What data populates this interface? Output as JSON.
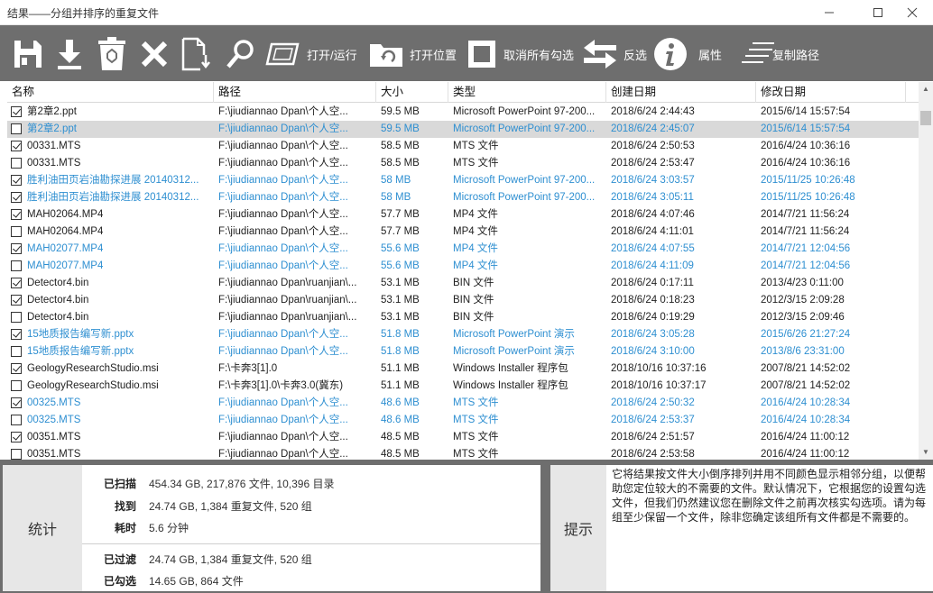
{
  "window": {
    "title": "结果——分组并排序的重复文件"
  },
  "toolbar": {
    "open_run": "打开/运行",
    "open_location": "打开位置",
    "uncheck_all": "取消所有勾选",
    "invert": "反选",
    "properties": "属性",
    "copy_path": "复制路径"
  },
  "table": {
    "columns": [
      "名称",
      "路径",
      "大小",
      "类型",
      "创建日期",
      "修改日期"
    ],
    "rows": [
      {
        "name": "第2章2.ppt",
        "path": "F:\\jiudiannao  Dpan\\个人空...",
        "size": "59.5 MB",
        "type": "Microsoft PowerPoint 97-200...",
        "created": "2018/6/24 2:44:43",
        "modified": "2015/6/14 15:57:54",
        "checked": true,
        "blue": false,
        "selected": false
      },
      {
        "name": "第2章2.ppt",
        "path": "F:\\jiudiannao  Dpan\\个人空...",
        "size": "59.5 MB",
        "type": "Microsoft PowerPoint 97-200...",
        "created": "2018/6/24 2:45:07",
        "modified": "2015/6/14 15:57:54",
        "checked": false,
        "blue": true,
        "selected": true
      },
      {
        "name": "00331.MTS",
        "path": "F:\\jiudiannao  Dpan\\个人空...",
        "size": "58.5 MB",
        "type": "MTS 文件",
        "created": "2018/6/24 2:50:53",
        "modified": "2016/4/24 10:36:16",
        "checked": true,
        "blue": false,
        "selected": false
      },
      {
        "name": "00331.MTS",
        "path": "F:\\jiudiannao  Dpan\\个人空...",
        "size": "58.5 MB",
        "type": "MTS 文件",
        "created": "2018/6/24 2:53:47",
        "modified": "2016/4/24 10:36:16",
        "checked": false,
        "blue": false,
        "selected": false
      },
      {
        "name": "胜利油田页岩油勘探进展 20140312...",
        "path": "F:\\jiudiannao  Dpan\\个人空...",
        "size": "58 MB",
        "type": "Microsoft PowerPoint 97-200...",
        "created": "2018/6/24 3:03:57",
        "modified": "2015/11/25 10:26:48",
        "checked": true,
        "blue": true,
        "selected": false
      },
      {
        "name": "胜利油田页岩油勘探进展 20140312...",
        "path": "F:\\jiudiannao  Dpan\\个人空...",
        "size": "58 MB",
        "type": "Microsoft PowerPoint 97-200...",
        "created": "2018/6/24 3:05:11",
        "modified": "2015/11/25 10:26:48",
        "checked": true,
        "blue": true,
        "selected": false
      },
      {
        "name": "MAH02064.MP4",
        "path": "F:\\jiudiannao  Dpan\\个人空...",
        "size": "57.7 MB",
        "type": "MP4 文件",
        "created": "2018/6/24 4:07:46",
        "modified": "2014/7/21 11:56:24",
        "checked": true,
        "blue": false,
        "selected": false
      },
      {
        "name": "MAH02064.MP4",
        "path": "F:\\jiudiannao  Dpan\\个人空...",
        "size": "57.7 MB",
        "type": "MP4 文件",
        "created": "2018/6/24 4:11:01",
        "modified": "2014/7/21 11:56:24",
        "checked": false,
        "blue": false,
        "selected": false
      },
      {
        "name": "MAH02077.MP4",
        "path": "F:\\jiudiannao  Dpan\\个人空...",
        "size": "55.6 MB",
        "type": "MP4 文件",
        "created": "2018/6/24 4:07:55",
        "modified": "2014/7/21 12:04:56",
        "checked": true,
        "blue": true,
        "selected": false
      },
      {
        "name": "MAH02077.MP4",
        "path": "F:\\jiudiannao  Dpan\\个人空...",
        "size": "55.6 MB",
        "type": "MP4 文件",
        "created": "2018/6/24 4:11:09",
        "modified": "2014/7/21 12:04:56",
        "checked": false,
        "blue": true,
        "selected": false
      },
      {
        "name": "Detector4.bin",
        "path": "F:\\jiudiannao  Dpan\\ruanjian\\...",
        "size": "53.1 MB",
        "type": "BIN 文件",
        "created": "2018/6/24 0:17:11",
        "modified": "2013/4/23 0:11:00",
        "checked": true,
        "blue": false,
        "selected": false
      },
      {
        "name": "Detector4.bin",
        "path": "F:\\jiudiannao  Dpan\\ruanjian\\...",
        "size": "53.1 MB",
        "type": "BIN 文件",
        "created": "2018/6/24 0:18:23",
        "modified": "2012/3/15 2:09:28",
        "checked": true,
        "blue": false,
        "selected": false
      },
      {
        "name": "Detector4.bin",
        "path": "F:\\jiudiannao  Dpan\\ruanjian\\...",
        "size": "53.1 MB",
        "type": "BIN 文件",
        "created": "2018/6/24 0:19:29",
        "modified": "2012/3/15 2:09:46",
        "checked": false,
        "blue": false,
        "selected": false
      },
      {
        "name": "15地质报告编写新.pptx",
        "path": "F:\\jiudiannao  Dpan\\个人空...",
        "size": "51.8 MB",
        "type": "Microsoft PowerPoint 演示",
        "created": "2018/6/24 3:05:28",
        "modified": "2015/6/26 21:27:24",
        "checked": true,
        "blue": true,
        "selected": false
      },
      {
        "name": "15地质报告编写新.pptx",
        "path": "F:\\jiudiannao  Dpan\\个人空...",
        "size": "51.8 MB",
        "type": "Microsoft PowerPoint 演示",
        "created": "2018/6/24 3:10:00",
        "modified": "2013/8/6 23:31:00",
        "checked": false,
        "blue": true,
        "selected": false
      },
      {
        "name": "GeologyResearchStudio.msi",
        "path": "F:\\卡奔3[1].0",
        "size": "51.1 MB",
        "type": "Windows Installer 程序包",
        "created": "2018/10/16 10:37:16",
        "modified": "2007/8/21 14:52:02",
        "checked": true,
        "blue": false,
        "selected": false
      },
      {
        "name": "GeologyResearchStudio.msi",
        "path": "F:\\卡奔3[1].0\\卡奔3.0(冀东)",
        "size": "51.1 MB",
        "type": "Windows Installer 程序包",
        "created": "2018/10/16 10:37:17",
        "modified": "2007/8/21 14:52:02",
        "checked": false,
        "blue": false,
        "selected": false
      },
      {
        "name": "00325.MTS",
        "path": "F:\\jiudiannao  Dpan\\个人空...",
        "size": "48.6 MB",
        "type": "MTS 文件",
        "created": "2018/6/24 2:50:32",
        "modified": "2016/4/24 10:28:34",
        "checked": true,
        "blue": true,
        "selected": false
      },
      {
        "name": "00325.MTS",
        "path": "F:\\jiudiannao  Dpan\\个人空...",
        "size": "48.6 MB",
        "type": "MTS 文件",
        "created": "2018/6/24 2:53:37",
        "modified": "2016/4/24 10:28:34",
        "checked": false,
        "blue": true,
        "selected": false
      },
      {
        "name": "00351.MTS",
        "path": "F:\\jiudiannao  Dpan\\个人空...",
        "size": "48.5 MB",
        "type": "MTS 文件",
        "created": "2018/6/24 2:51:57",
        "modified": "2016/4/24 11:00:12",
        "checked": true,
        "blue": false,
        "selected": false
      },
      {
        "name": "00351.MTS",
        "path": "F:\\jiudiannao  Dpan\\个人空...",
        "size": "48.5 MB",
        "type": "MTS 文件",
        "created": "2018/6/24 2:53:58",
        "modified": "2016/4/24 11:00:12",
        "checked": false,
        "blue": false,
        "selected": false
      }
    ]
  },
  "stats": {
    "label": "统计",
    "scanned_key": "已扫描",
    "scanned_val": "454.34 GB, 217,876 文件, 10,396 目录",
    "found_key": "找到",
    "found_val": "24.74 GB, 1,384 重复文件, 520 组",
    "time_key": "耗时",
    "time_val": "5.6 分钟",
    "filtered_key": "已过滤",
    "filtered_val": "24.74 GB, 1,384 重复文件, 520 组",
    "checked_key": "已勾选",
    "checked_val": "14.65 GB, 864 文件"
  },
  "tips": {
    "label": "提示",
    "text": "它将结果按文件大小倒序排列并用不同颜色显示相邻分组，以便帮助您定位较大的不需要的文件。默认情况下，它根据您的设置勾选文件，但我们仍然建议您在删除文件之前再次核实勾选项。请为每组至少保留一个文件，除非您确定该组所有文件都是不需要的。"
  },
  "colors": {
    "toolbar_bg": "#6e6e6e",
    "group_blue": "#2e8fd1",
    "selected_row": "#d9d9d9"
  }
}
